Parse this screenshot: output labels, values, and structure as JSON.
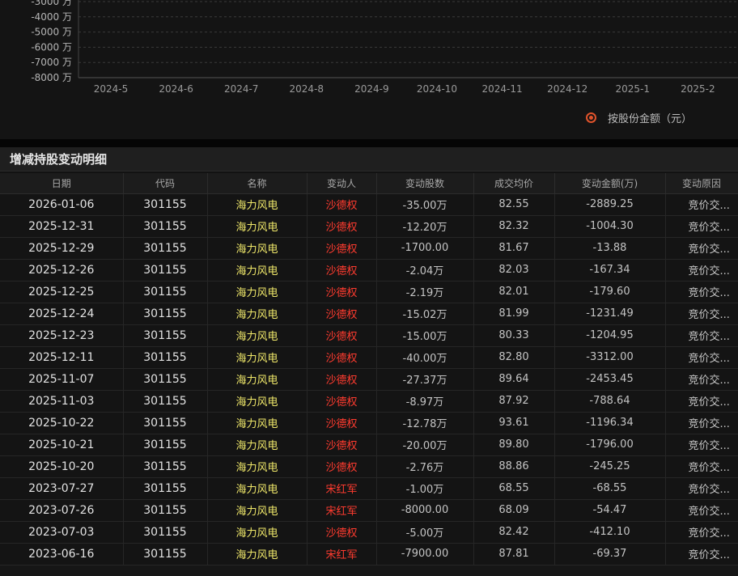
{
  "chart": {
    "y_labels": [
      "-3000 万",
      "-4000 万",
      "-5000 万",
      "-6000 万",
      "-7000 万",
      "-8000 万"
    ],
    "x_labels": [
      "2024-5",
      "2024-6",
      "2024-7",
      "2024-8",
      "2024-9",
      "2024-10",
      "2024-11",
      "2024-12",
      "2025-1",
      "2025-2"
    ],
    "legend_label": "按股份金额（元）",
    "accent_color": "#e0532b"
  },
  "section": {
    "title": "增减持股变动明细"
  },
  "table": {
    "headers": [
      "日期",
      "代码",
      "名称",
      "变动人",
      "变动股数",
      "成交均价",
      "变动金额(万)",
      "变动原因"
    ],
    "rows": [
      [
        "2026-01-06",
        "301155",
        "海力风电",
        "沙德权",
        "-35.00万",
        "82.55",
        "-2889.25",
        "竞价交..."
      ],
      [
        "2025-12-31",
        "301155",
        "海力风电",
        "沙德权",
        "-12.20万",
        "82.32",
        "-1004.30",
        "竞价交..."
      ],
      [
        "2025-12-29",
        "301155",
        "海力风电",
        "沙德权",
        "-1700.00",
        "81.67",
        "-13.88",
        "竞价交..."
      ],
      [
        "2025-12-26",
        "301155",
        "海力风电",
        "沙德权",
        "-2.04万",
        "82.03",
        "-167.34",
        "竞价交..."
      ],
      [
        "2025-12-25",
        "301155",
        "海力风电",
        "沙德权",
        "-2.19万",
        "82.01",
        "-179.60",
        "竞价交..."
      ],
      [
        "2025-12-24",
        "301155",
        "海力风电",
        "沙德权",
        "-15.02万",
        "81.99",
        "-1231.49",
        "竞价交..."
      ],
      [
        "2025-12-23",
        "301155",
        "海力风电",
        "沙德权",
        "-15.00万",
        "80.33",
        "-1204.95",
        "竞价交..."
      ],
      [
        "2025-12-11",
        "301155",
        "海力风电",
        "沙德权",
        "-40.00万",
        "82.80",
        "-3312.00",
        "竞价交..."
      ],
      [
        "2025-11-07",
        "301155",
        "海力风电",
        "沙德权",
        "-27.37万",
        "89.64",
        "-2453.45",
        "竞价交..."
      ],
      [
        "2025-11-03",
        "301155",
        "海力风电",
        "沙德权",
        "-8.97万",
        "87.92",
        "-788.64",
        "竞价交..."
      ],
      [
        "2025-10-22",
        "301155",
        "海力风电",
        "沙德权",
        "-12.78万",
        "93.61",
        "-1196.34",
        "竞价交..."
      ],
      [
        "2025-10-21",
        "301155",
        "海力风电",
        "沙德权",
        "-20.00万",
        "89.80",
        "-1796.00",
        "竞价交..."
      ],
      [
        "2025-10-20",
        "301155",
        "海力风电",
        "沙德权",
        "-2.76万",
        "88.86",
        "-245.25",
        "竞价交..."
      ],
      [
        "2023-07-27",
        "301155",
        "海力风电",
        "宋红军",
        "-1.00万",
        "68.55",
        "-68.55",
        "竞价交..."
      ],
      [
        "2023-07-26",
        "301155",
        "海力风电",
        "宋红军",
        "-8000.00",
        "68.09",
        "-54.47",
        "竞价交..."
      ],
      [
        "2023-07-03",
        "301155",
        "海力风电",
        "沙德权",
        "-5.00万",
        "82.42",
        "-412.10",
        "竞价交..."
      ],
      [
        "2023-06-16",
        "301155",
        "海力风电",
        "宋红军",
        "-7900.00",
        "87.81",
        "-69.37",
        "竞价交..."
      ]
    ]
  }
}
